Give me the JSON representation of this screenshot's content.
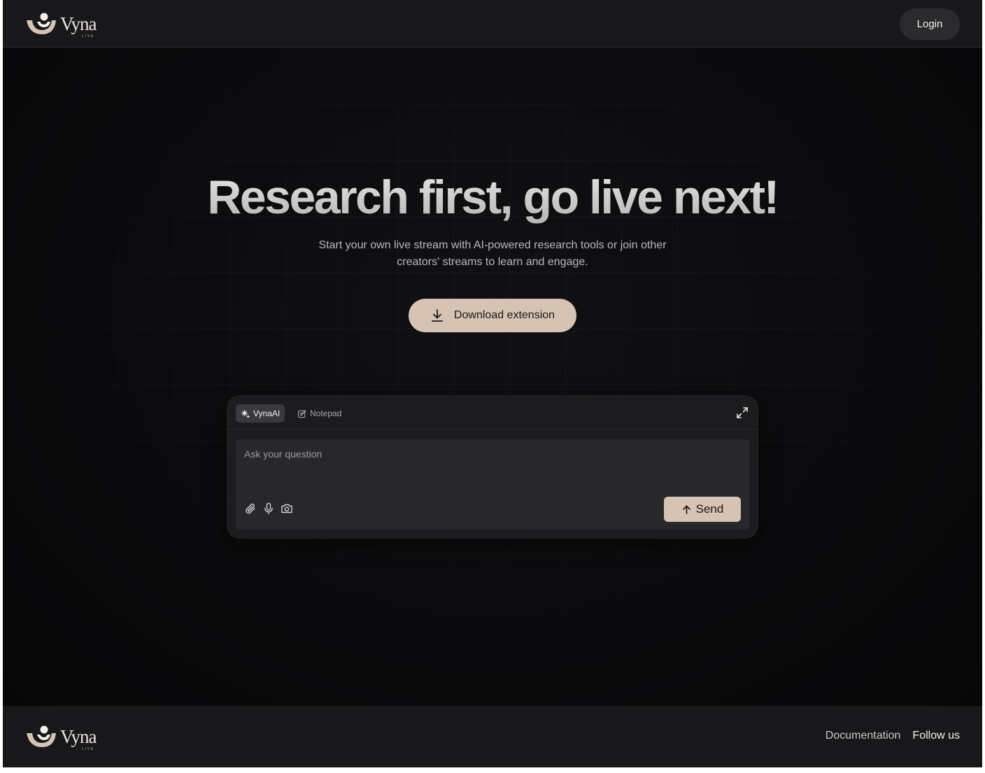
{
  "brand": {
    "name": "Vyna",
    "sub": "LIVE",
    "accent_color": "#d6c3b3"
  },
  "header": {
    "login_label": "Login"
  },
  "hero": {
    "title": "Research first, go live next!",
    "subtitle": "Start your own live stream with AI-powered research tools or join other creators' streams to learn and engage.",
    "download_label": "Download extension",
    "download_icon": "download-icon"
  },
  "chat": {
    "tabs": [
      {
        "label": "VynaAI",
        "icon": "sparkle-icon",
        "active": true
      },
      {
        "label": "Notepad",
        "icon": "notepad-icon",
        "active": false
      }
    ],
    "expand_icon": "expand-icon",
    "input_placeholder": "Ask your question",
    "tools": [
      "paperclip-icon",
      "microphone-icon",
      "camera-icon"
    ],
    "send_label": "Send"
  },
  "footer": {
    "links": [
      "Documentation",
      "Follow us"
    ]
  }
}
